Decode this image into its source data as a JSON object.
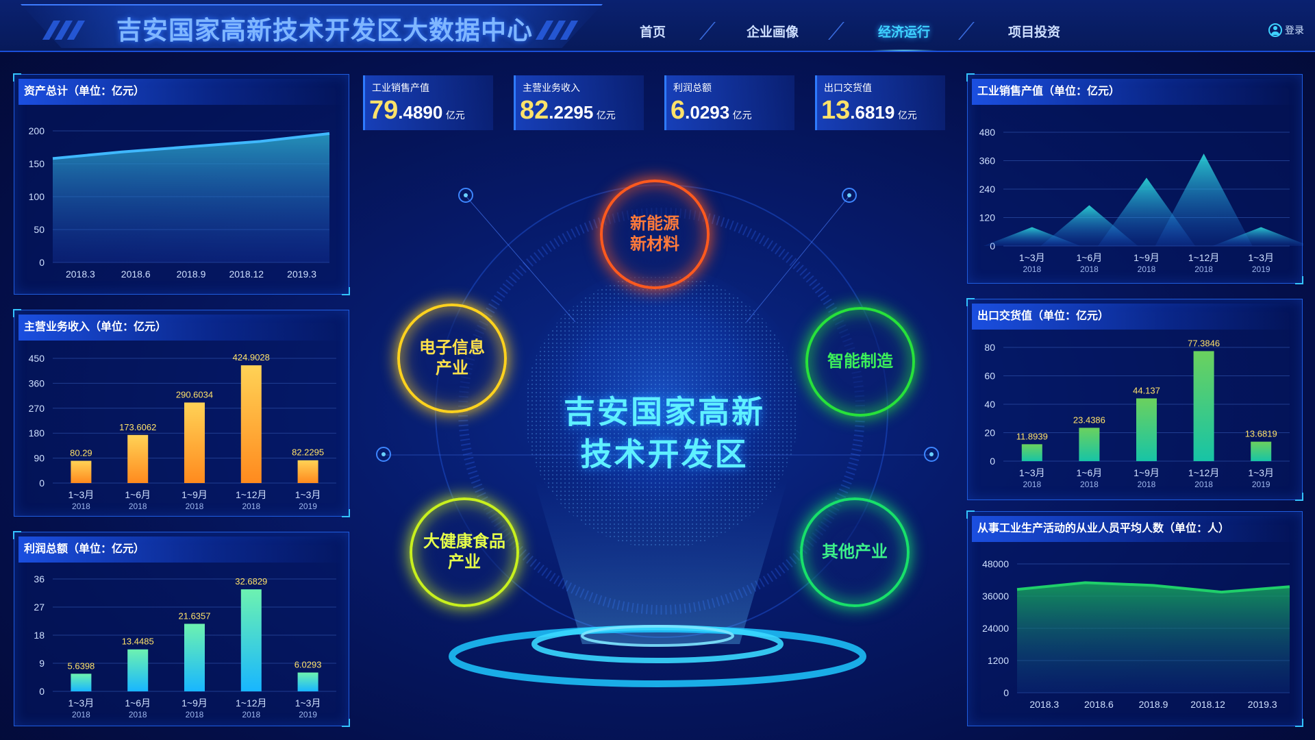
{
  "header": {
    "title": "吉安国家高新技术开发区大数据中心",
    "nav": [
      "首页",
      "企业画像",
      "经济运行",
      "项目投资"
    ],
    "active_nav": "经济运行",
    "login_label": "登录"
  },
  "colors": {
    "accent": "#3fd3ff",
    "panel_border": "#1f5de0",
    "bar_orange_top": "#ffd256",
    "bar_orange_bottom": "#ff8a1e",
    "bar_cyan_top": "#6df2b0",
    "bar_cyan_bottom": "#18b6ff",
    "bar_green_top": "#6bd15e",
    "bar_green_bottom": "#17c4a6",
    "label_yellow": "#ffe26a"
  },
  "kpis": [
    {
      "label": "工业销售产值",
      "int": "79",
      "dec": ".4890",
      "unit": "亿元"
    },
    {
      "label": "主营业务收入",
      "int": "82",
      "dec": ".2295",
      "unit": "亿元"
    },
    {
      "label": "利润总额",
      "int": "6",
      "dec": ".0293",
      "unit": "亿元"
    },
    {
      "label": "出口交货值",
      "int": "13",
      "dec": ".6819",
      "unit": "亿元"
    }
  ],
  "center": {
    "title": "吉安国家高新\n技术开发区",
    "industries": [
      {
        "label": "新能源\n新材料",
        "color": "#ff5a1e",
        "text": "#ff7a3a",
        "icon": "circle-orange"
      },
      {
        "label": "电子信息\n产业",
        "color": "#ffd21e",
        "text": "#ffe14a",
        "icon": "circle-yellow"
      },
      {
        "label": "智能制造",
        "color": "#27e23a",
        "text": "#3cf05a",
        "icon": "circle-green"
      },
      {
        "label": "大健康食品\n产业",
        "color": "#c8f01e",
        "text": "#e6ff4a",
        "icon": "circle-lime"
      },
      {
        "label": "其他产业",
        "color": "#18e06a",
        "text": "#3cf08a",
        "icon": "circle-emerald"
      }
    ]
  },
  "chart_data": [
    {
      "id": "assets",
      "type": "area",
      "title": "资产总计（单位：亿元）",
      "x": [
        "2018.3",
        "2018.6",
        "2018.9",
        "2018.12",
        "2019.3"
      ],
      "values": [
        158,
        168,
        176,
        184,
        196
      ],
      "ylim": [
        0,
        200
      ],
      "yticks": [
        "0",
        "50",
        "100",
        "150",
        "200"
      ],
      "grid": true
    },
    {
      "id": "revenue",
      "type": "bar",
      "title": "主营业务收入（单位：亿元）",
      "categories": [
        "1~3月",
        "1~6月",
        "1~9月",
        "1~12月",
        "1~3月"
      ],
      "years": [
        "2018",
        "2018",
        "2018",
        "2018",
        "2019"
      ],
      "values": [
        80.29,
        173.6062,
        290.6034,
        424.9028,
        82.2295
      ],
      "labels": [
        "80.29",
        "173.6062",
        "290.6034",
        "424.9028",
        "82.2295"
      ],
      "ylim": [
        0,
        450
      ],
      "yticks": [
        "0",
        "90",
        "180",
        "270",
        "360",
        "450"
      ],
      "grid": true
    },
    {
      "id": "profit",
      "type": "bar",
      "title": "利润总额（单位：亿元）",
      "categories": [
        "1~3月",
        "1~6月",
        "1~9月",
        "1~12月",
        "1~3月"
      ],
      "years": [
        "2018",
        "2018",
        "2018",
        "2018",
        "2019"
      ],
      "values": [
        5.6398,
        13.4485,
        21.6357,
        32.6829,
        6.0293
      ],
      "labels": [
        "5.6398",
        "13.4485",
        "21.6357",
        "32.6829",
        "6.0293"
      ],
      "ylim": [
        0,
        36
      ],
      "yticks": [
        "0",
        "9",
        "18",
        "27",
        "36"
      ],
      "grid": true
    },
    {
      "id": "sales",
      "type": "area",
      "title": "工业销售产值（单位：亿元）",
      "categories": [
        "1~3月",
        "1~6月",
        "1~9月",
        "1~12月",
        "1~3月"
      ],
      "years": [
        "2018",
        "2018",
        "2018",
        "2018",
        "2019"
      ],
      "values": [
        79.489,
        172,
        288,
        390,
        79.489
      ],
      "ylim": [
        0,
        480
      ],
      "yticks": [
        "0",
        "120",
        "240",
        "360",
        "480"
      ],
      "grid": true
    },
    {
      "id": "export",
      "type": "bar",
      "title": "出口交货值（单位：亿元）",
      "categories": [
        "1~3月",
        "1~6月",
        "1~9月",
        "1~12月",
        "1~3月"
      ],
      "years": [
        "2018",
        "2018",
        "2018",
        "2018",
        "2019"
      ],
      "values": [
        11.8939,
        23.4386,
        44.137,
        77.3846,
        13.6819
      ],
      "labels": [
        "11.8939",
        "23.4386",
        "44.137",
        "77.3846",
        "13.6819"
      ],
      "ylim": [
        0,
        80
      ],
      "yticks": [
        "0",
        "20",
        "40",
        "60",
        "80"
      ],
      "grid": true
    },
    {
      "id": "employees",
      "type": "area",
      "title": "从事工业生产活动的从业人员平均人数（单位：人）",
      "x": [
        "2018.3",
        "2018.6",
        "2018.9",
        "2018.12",
        "2019.3"
      ],
      "values": [
        38500,
        41000,
        40000,
        37500,
        39500
      ],
      "ylim": [
        0,
        48000
      ],
      "yticks": [
        "0",
        "1200",
        "24000",
        "36000",
        "48000"
      ],
      "grid": true
    }
  ]
}
